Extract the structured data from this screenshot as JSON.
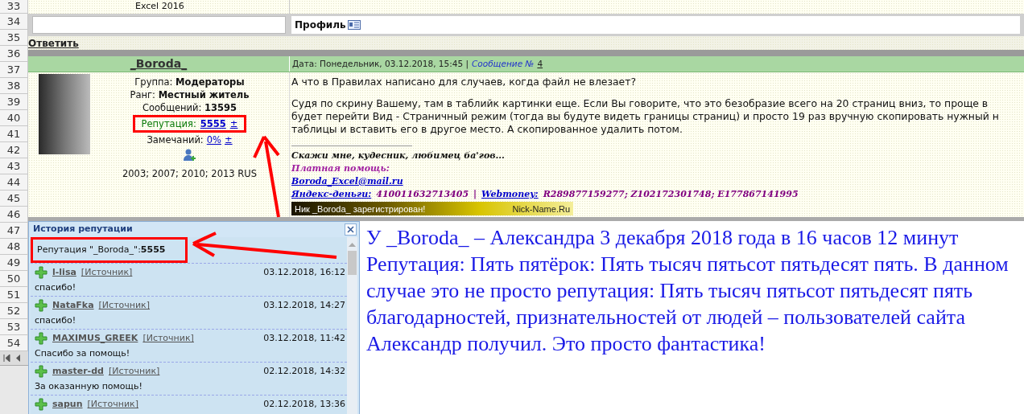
{
  "row_numbers": [
    "33",
    "34",
    "35",
    "36",
    "37",
    "38",
    "39",
    "40",
    "41",
    "42",
    "43",
    "44",
    "45",
    "46",
    "47",
    "48",
    "49",
    "50",
    "51",
    "52",
    "53",
    "54"
  ],
  "top": {
    "caption": "Excel 2016",
    "profile_button": "Профиль",
    "reply_link": "Ответить"
  },
  "post": {
    "author": "_Boroda_",
    "profile_lines": [
      "Группа: **Модераторы**",
      "Ранг: **Местный житель**",
      "Сообщений: **13595**"
    ],
    "reputation_label": "Репутация:",
    "reputation": "5555",
    "reputation_toggle": "±",
    "warnings_label": "Замечаний:",
    "warnings": "0%",
    "warnings_toggle": "±",
    "versions": "2003; 2007; 2010; 2013 RUS",
    "date": "Дата: Понедельник, 03.12.2018, 15:45 |",
    "message_link": "Сообщение №",
    "message_number": "4",
    "question": "А что в Правилах написано для случаев, когда файл не влезает?",
    "answer_lines": [
      "Судя по скрину Вашему, там в таблийк картинки еще. Если Вы говорите, что это безобразие всего на 20 страниц вниз, то проще в",
      "будет перейти Вид - Страничный режим (тогда вы будуте видеть границы страниц) и просто 19 раз вручную скопировать нужный н",
      "таблицы и вставить его в другое место. А скопированное удалить потом."
    ],
    "signature": {
      "motto": "Скажи мне, кудесник, любимец ба'гов...",
      "paid_help": "Платная помощь:",
      "email": "Boroda_Excel@mail.ru",
      "yandex_label": "Яндекс-деньги:",
      "yandex_value": "410011632713405",
      "separator": "|",
      "webmoney_label": "Webmoney:",
      "webmoney_value": "R289877159277; Z102172301748; E177867141995"
    },
    "banner": {
      "text": "Ник _Boroda_ зарегистрирован!",
      "site": "Nick-Name.Ru"
    }
  },
  "popup": {
    "title": "История репутации",
    "summary": "Репутация \"_Boroda_\":**5555**",
    "entries": [
      {
        "user": "l-lisa",
        "source": "[Источник]",
        "date": "03.12.2018, 16:12",
        "comment": "спасибо!"
      },
      {
        "user": "NataFka",
        "source": "[Источник]",
        "date": "03.12.2018, 14:27",
        "comment": "спасибо!"
      },
      {
        "user": "MAXIMUS_GREEK",
        "source": "[Источник]",
        "date": "03.12.2018, 11:42",
        "comment": "Спасибо за помощь!"
      },
      {
        "user": "master-dd",
        "source": "[Источник]",
        "date": "02.12.2018, 14:32",
        "comment": "За оказанную помощь!"
      },
      {
        "user": "sapun",
        "source": "[Источник]",
        "date": "02.12.2018, 13:36"
      }
    ]
  },
  "annotation": "У _Boroda_ – Александра 3 декабря 2018 года в 16 часов 12 минут Репутация: Пять пятёрок: Пять тысяч пятьсот пятьдесят пять. В данном случае это не просто репутация: Пять тысяч пятьсот пятьдесят пять благодарностей, признательностей от людей – пользователей сайта Александр получил. Это просто фантастика!"
}
